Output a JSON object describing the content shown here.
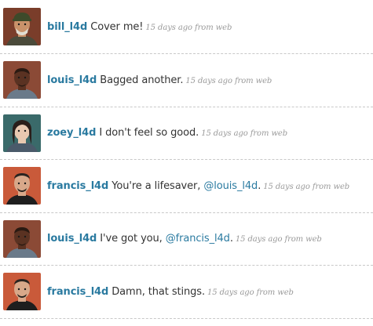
{
  "timeline": {
    "statuses": [
      {
        "user": "bill_l4d",
        "avatar_icon": "bill-avatar",
        "avatar_colors": {
          "bg": "#7a3d2a",
          "skin": "#c9926a",
          "hair": "#e0ddd2",
          "cap": "#3d4a2a"
        },
        "text_before": "Cover me!",
        "mention": "",
        "text_after": "",
        "timestamp": "15 days ago from web"
      },
      {
        "user": "louis_l4d",
        "avatar_icon": "louis-avatar",
        "avatar_colors": {
          "bg": "#8b4a36",
          "skin": "#5a3222",
          "hair": "#2a1a12",
          "shirt": "#6a7a8a"
        },
        "text_before": "Bagged another.",
        "mention": "",
        "text_after": "",
        "timestamp": "15 days ago from web"
      },
      {
        "user": "zoey_l4d",
        "avatar_icon": "zoey-avatar",
        "avatar_colors": {
          "bg": "#3a6a6a",
          "skin": "#e8c8b0",
          "hair": "#2a1e1a",
          "shirt": "#4a5a6a"
        },
        "text_before": "I don't feel so good.",
        "mention": "",
        "text_after": "",
        "timestamp": "15 days ago from web"
      },
      {
        "user": "francis_l4d",
        "avatar_icon": "francis-avatar",
        "avatar_colors": {
          "bg": "#c95a3a",
          "skin": "#d8a88a",
          "hair": "#2a2420",
          "shirt": "#1e1e1e"
        },
        "text_before": "You're a lifesaver,",
        "mention": "@louis_l4d",
        "text_after": ".",
        "timestamp": "15 days ago from web"
      },
      {
        "user": "louis_l4d",
        "avatar_icon": "louis-avatar",
        "avatar_colors": {
          "bg": "#8b4a36",
          "skin": "#5a3222",
          "hair": "#2a1a12",
          "shirt": "#6a7a8a"
        },
        "text_before": "I've got you,",
        "mention": "@francis_l4d",
        "text_after": ".",
        "timestamp": "15 days ago from web"
      },
      {
        "user": "francis_l4d",
        "avatar_icon": "francis-avatar",
        "avatar_colors": {
          "bg": "#c95a3a",
          "skin": "#d8a88a",
          "hair": "#2a2420",
          "shirt": "#1e1e1e"
        },
        "text_before": "Damn, that stings.",
        "mention": "",
        "text_after": "",
        "timestamp": "15 days ago from web"
      }
    ]
  }
}
